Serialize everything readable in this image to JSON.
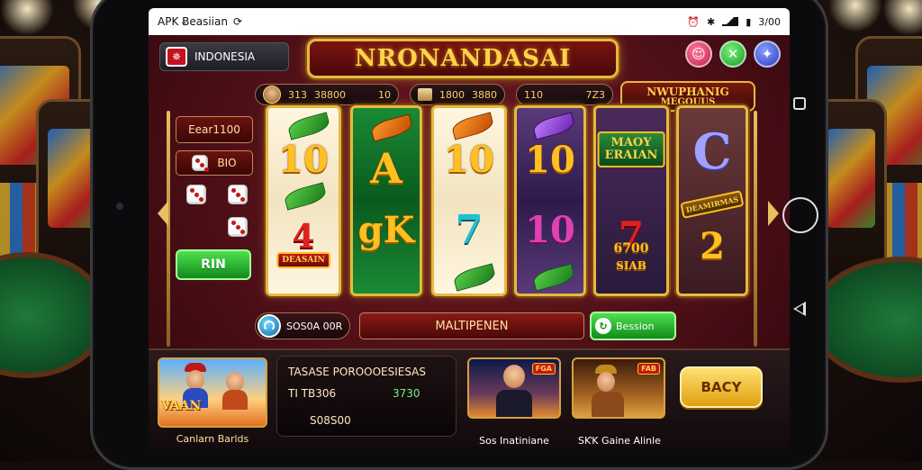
{
  "status_bar": {
    "app_title": "APK Ƀeasiian",
    "right_text": "3/00"
  },
  "header": {
    "region_label": "INDONESIA",
    "flag_glyph": "✵",
    "title": "NRONANDASAI",
    "icons": [
      "person-icon",
      "close-icon",
      "settings-icon"
    ]
  },
  "info_row": {
    "player_id": "313",
    "balance_label": "38800",
    "balance_count": "10",
    "bet_a": "1800",
    "bet_b": "3880",
    "win_a": "110",
    "win_b": "7Z3",
    "jackpot_line1": "NWUPHANIG",
    "jackpot_line2": "MEGOUUS"
  },
  "controls": {
    "bet_label": "Eear1100",
    "dice_label": "BIO",
    "run_label": "RIN",
    "globe_label": "SOS0A 00R",
    "multi_label": "MALTIPENEN",
    "session_label": "Bession"
  },
  "reels": {
    "r1": {
      "top": "10",
      "bottom": "DEASAIN"
    },
    "r2": {
      "top": "A",
      "bottom": "gK"
    },
    "r3": {
      "top": "10",
      "bottom": "7"
    },
    "r4": {
      "top": "10",
      "bottom": "10"
    },
    "r5": {
      "top_line1": "MAOY",
      "top_line2": "ERAIAN",
      "bottom": "7",
      "bottom_text": "6700",
      "bottom_text2": "SIAB"
    },
    "r6": {
      "top": "C",
      "tag": "DEAMIRMAS",
      "bottom": "2"
    }
  },
  "bottom_panel": {
    "promo_logo": "VAAN",
    "promo_caption": "Canlarn Barlds",
    "stats_title": "TASASE POROOOESIESAS",
    "stats_value_1": "TI TB306",
    "stats_value_2": "3730",
    "stats_value_3": "S08S00",
    "player1_caption": "Sos Inatiniane",
    "player1_tag": "FGA",
    "player2_caption": "SƘK Gaine Alinle",
    "player2_tag": "FAB",
    "play_label": "BACY"
  },
  "colors": {
    "accent_gold": "#e8b840",
    "felt_red": "#6e1a22",
    "play_green": "#128a1a"
  }
}
